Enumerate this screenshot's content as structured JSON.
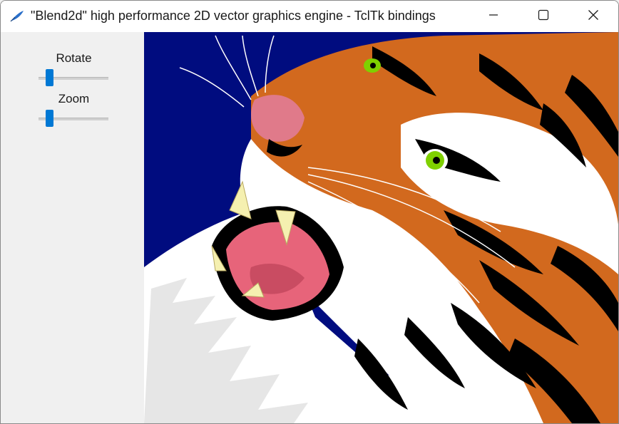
{
  "window": {
    "title": "\"Blend2d\" high performance 2D vector graphics engine - TclTk bindings",
    "app_icon": "feather-pen-icon",
    "controls": [
      "minimize-icon",
      "maximize-icon",
      "close-icon"
    ]
  },
  "sidebar": {
    "rotate": {
      "label": "Rotate",
      "value_fraction": 0.12
    },
    "zoom": {
      "label": "Zoom",
      "value_fraction": 0.12
    }
  },
  "canvas": {
    "image": "tiger-illustration",
    "background_color": "#000c7f"
  },
  "colors": {
    "accent": "#0078d4",
    "tiger_orange": "#d2691e",
    "eye_green": "#7fd000"
  }
}
